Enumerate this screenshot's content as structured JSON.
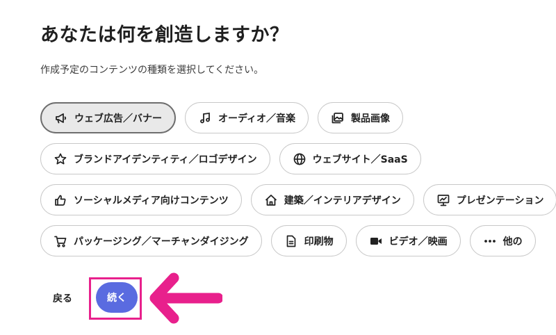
{
  "page": {
    "title": "あなたは何を創造しますか？",
    "subtitle": "作成予定のコンテンツの種類を選択してください。"
  },
  "categories": [
    {
      "label": "ウェブ広告／バナー",
      "icon": "megaphone-icon",
      "selected": true
    },
    {
      "label": "オーディオ／音楽",
      "icon": "music-note-icon",
      "selected": false
    },
    {
      "label": "製品画像",
      "icon": "image-gallery-icon",
      "selected": false
    },
    {
      "label": "ブランドアイデンティティ／ロゴデザイン",
      "icon": "star-icon",
      "selected": false
    },
    {
      "label": "ウェブサイト／SaaS",
      "icon": "globe-icon",
      "selected": false
    },
    {
      "label": "ソーシャルメディア向けコンテンツ",
      "icon": "thumbs-up-icon",
      "selected": false
    },
    {
      "label": "建築／インテリアデザイン",
      "icon": "house-icon",
      "selected": false
    },
    {
      "label": "プレゼンテーション",
      "icon": "presentation-icon",
      "selected": false
    },
    {
      "label": "パッケージング／マーチャンダイジング",
      "icon": "shopping-cart-icon",
      "selected": false
    },
    {
      "label": "印刷物",
      "icon": "document-icon",
      "selected": false
    },
    {
      "label": "ビデオ／映画",
      "icon": "video-camera-icon",
      "selected": false
    },
    {
      "label": "他の",
      "icon": "more-dots-icon",
      "selected": false
    }
  ],
  "actions": {
    "back_label": "戻る",
    "continue_label": "続く"
  },
  "colors": {
    "primary_button": "#5a6be0",
    "annotation_pink": "#e8208c",
    "selected_chip_bg": "#e9e9e9"
  }
}
